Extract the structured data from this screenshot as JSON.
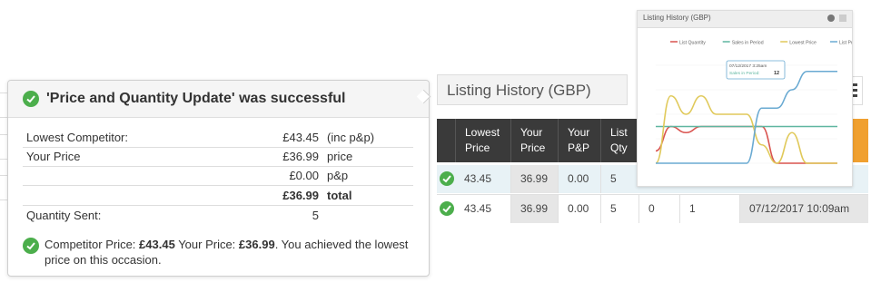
{
  "popup": {
    "title": "'Price and Quantity Update' was successful",
    "rows": [
      {
        "label": "Lowest Competitor:",
        "value": "£43.45",
        "unit": "(inc p&p)"
      },
      {
        "label": "Your Price",
        "value": "£36.99",
        "unit": "price"
      },
      {
        "label": "",
        "value": "£0.00",
        "unit": "p&p"
      },
      {
        "label": "",
        "value": "£36.99",
        "unit": "total"
      },
      {
        "label": "Quantity Sent:",
        "value": "5",
        "unit": ""
      }
    ],
    "note": {
      "t1": "Competitor Price: ",
      "v1": "£43.45",
      "t2": " Your Price: ",
      "v2": "£36.99",
      "t3": ". You achieved the lowest price on this occasion."
    }
  },
  "listing": {
    "title": "Listing History (GBP)",
    "headers": [
      "Lowest Price",
      "Your Price",
      "Your P&P",
      "List Qty"
    ],
    "rows": [
      {
        "lowest": "43.45",
        "price": "36.99",
        "pp": "0.00",
        "qty": "5",
        "c5": "",
        "c6": "",
        "date": ""
      },
      {
        "lowest": "43.45",
        "price": "36.99",
        "pp": "0.00",
        "qty": "5",
        "c5": "0",
        "c6": "1",
        "date": "07/12/2017 10:09am"
      }
    ]
  },
  "chart_data": {
    "type": "line",
    "title": "Listing History (GBP)",
    "legend_position": "top",
    "series": [
      {
        "name": "List Quantity",
        "color": "#d9534f",
        "values": [
          2,
          6,
          5,
          6,
          6,
          6,
          6,
          6,
          0,
          0,
          0,
          0,
          0
        ]
      },
      {
        "name": "Sales in Period",
        "color": "#5fb6a0",
        "values": [
          6,
          6,
          6,
          6,
          6,
          6,
          6,
          6,
          6,
          6,
          6,
          6,
          6
        ]
      },
      {
        "name": "Lowest Price",
        "color": "#e0c95a",
        "values": [
          0,
          11,
          8,
          11,
          8,
          8,
          8,
          3,
          0,
          5,
          0,
          0,
          0
        ]
      },
      {
        "name": "List Price",
        "color": "#6aaad2",
        "values": [
          0,
          0,
          0,
          0,
          0,
          0,
          0,
          9,
          9,
          12,
          15,
          15,
          15
        ]
      }
    ],
    "tooltip": {
      "date": "07/12/2017 3:25am",
      "label": "Sales in Period:",
      "value": "12"
    }
  }
}
